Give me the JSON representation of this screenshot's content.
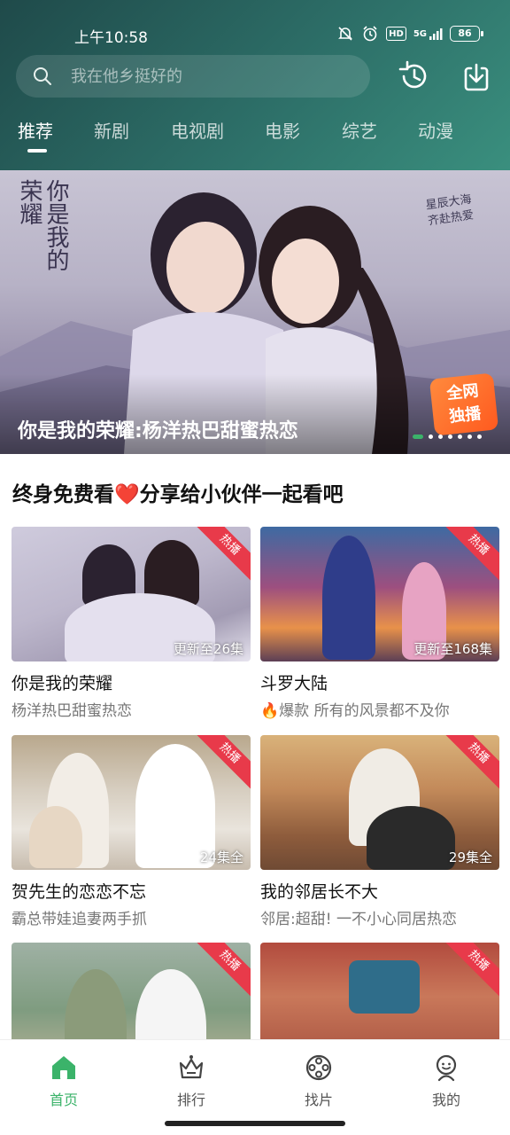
{
  "status_bar": {
    "time": "上午10:58",
    "network": "5G",
    "hd": "HD",
    "battery": "86"
  },
  "search": {
    "placeholder": "我在他乡挺好的"
  },
  "header_icons": [
    "history-icon",
    "download-icon"
  ],
  "tabs": [
    {
      "label": "推荐",
      "active": true
    },
    {
      "label": "新剧"
    },
    {
      "label": "电视剧"
    },
    {
      "label": "电影"
    },
    {
      "label": "综艺"
    },
    {
      "label": "动漫"
    }
  ],
  "banner": {
    "title": "你是我的荣耀:杨洋热巴甜蜜热恋",
    "badge": "全网\n独播",
    "logo_text": "你是我的荣耀",
    "slogan": "星辰大海\n齐赴热爱",
    "dots_count": 7,
    "active_dot": 0,
    "accent_color": "#3bb36a"
  },
  "section": {
    "title_before": "终身免费看",
    "heart": "❤️",
    "title_after": "分享给小伙伴一起看吧"
  },
  "cards": [
    {
      "title": "你是我的荣耀",
      "subtitle": "杨洋热巴甜蜜热恋",
      "episodes": "更新至26集",
      "tag": "热播"
    },
    {
      "title": "斗罗大陆",
      "subtitle": "🔥爆款 所有的风景都不及你",
      "episodes": "更新至168集",
      "tag": "热播"
    },
    {
      "title": "贺先生的恋恋不忘",
      "subtitle": "霸总带娃追妻两手抓",
      "episodes": "24集全",
      "tag": "热播"
    },
    {
      "title": "我的邻居长不大",
      "subtitle": "邻居:超甜! 一不小心同居热恋",
      "episodes": "29集全",
      "tag": "热播"
    },
    {
      "title": "",
      "subtitle": "",
      "episodes": "",
      "tag": "热播"
    },
    {
      "title": "",
      "subtitle": "",
      "episodes": "",
      "tag": "热播"
    }
  ],
  "bottom_nav": [
    {
      "label": "首页",
      "icon": "home-icon",
      "active": true
    },
    {
      "label": "排行",
      "icon": "ranking-icon"
    },
    {
      "label": "找片",
      "icon": "film-reel-icon"
    },
    {
      "label": "我的",
      "icon": "profile-icon"
    }
  ],
  "colors": {
    "header_start": "#1f4a4a",
    "header_end": "#3a8f7e",
    "accent": "#3bb36a",
    "hot_tag": "#e83a4a"
  }
}
